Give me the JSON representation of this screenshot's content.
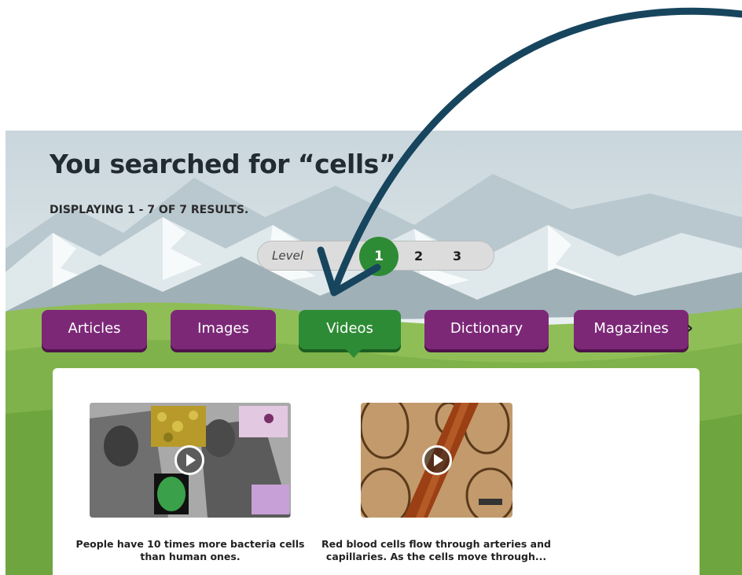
{
  "search": {
    "title": "You searched for “cells”",
    "results_summary": "DISPLAYING 1 - 7 OF 7 RESULTS."
  },
  "level": {
    "label": "Level",
    "options": [
      "1",
      "2",
      "3"
    ],
    "selected": "1"
  },
  "tabs": [
    {
      "label": "Articles"
    },
    {
      "label": "Images"
    },
    {
      "label": "Videos",
      "active": true
    },
    {
      "label": "Dictionary"
    },
    {
      "label": "Magazines"
    }
  ],
  "next_icon": "chevron-right-icon",
  "results": [
    {
      "caption": "People have 10 times more bacteria cells than human ones.",
      "icon": "play-icon"
    },
    {
      "caption": "Red blood cells flow through arteries and capillaries. As the cells move through...",
      "icon": "play-icon"
    }
  ],
  "colors": {
    "tab": "#7c2877",
    "tab_active": "#2e8b35",
    "annotation_arrow": "#17455e",
    "title": "#222a33"
  }
}
